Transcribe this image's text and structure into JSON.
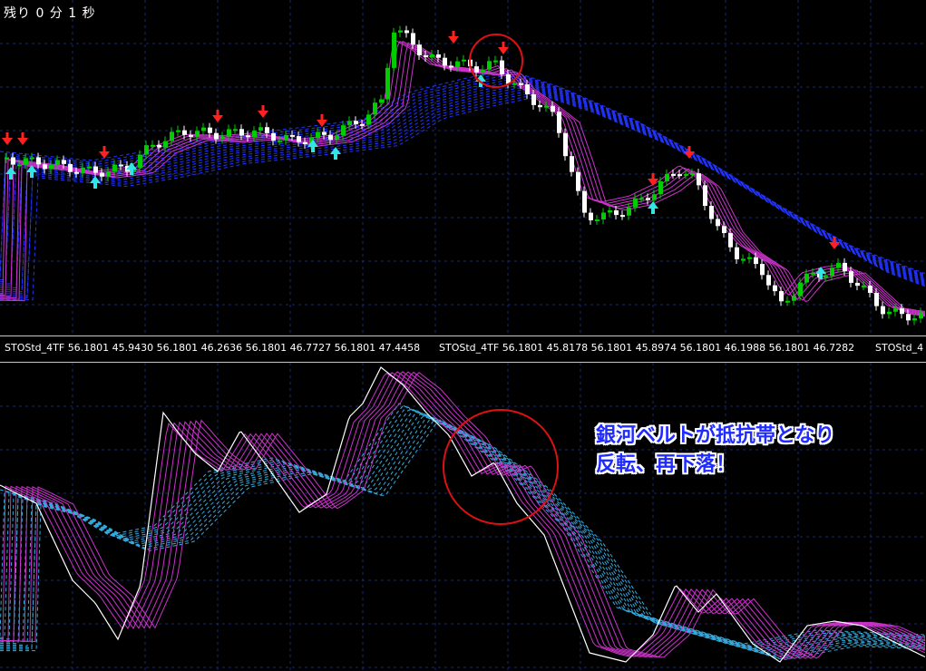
{
  "timer": {
    "label": "残り 0 分 1 秒"
  },
  "indicator_bar": {
    "segments": [
      {
        "name": "STOStd_4TF",
        "values": "56.1801 45.9430 56.1801 46.2636 56.1801 46.7727 56.1801 47.4458"
      },
      {
        "name": "STOStd_4TF",
        "values": "56.1801 45.8178 56.1801 45.8974 56.1801 46.1988 56.1801 46.7282"
      },
      {
        "name": "STOStd_4",
        "values": ""
      }
    ]
  },
  "annotation": {
    "line1": "銀河ベルトが抵抗帯となり",
    "line2": "反転、再下落！"
  },
  "colors": {
    "background": "#000000",
    "grid": "#1a2a6e",
    "bull_candle": "#00cc00",
    "bear_candle": "#ffffff",
    "ma_ribbon": "#cc33cc",
    "galaxy_belt": "#2233ff",
    "stoch_main": "#ffffff",
    "stoch_belt": "#33aadd",
    "sell_arrow": "#ff2020",
    "buy_arrow": "#33e6e6",
    "highlight_circle": "#dd1111"
  }
}
